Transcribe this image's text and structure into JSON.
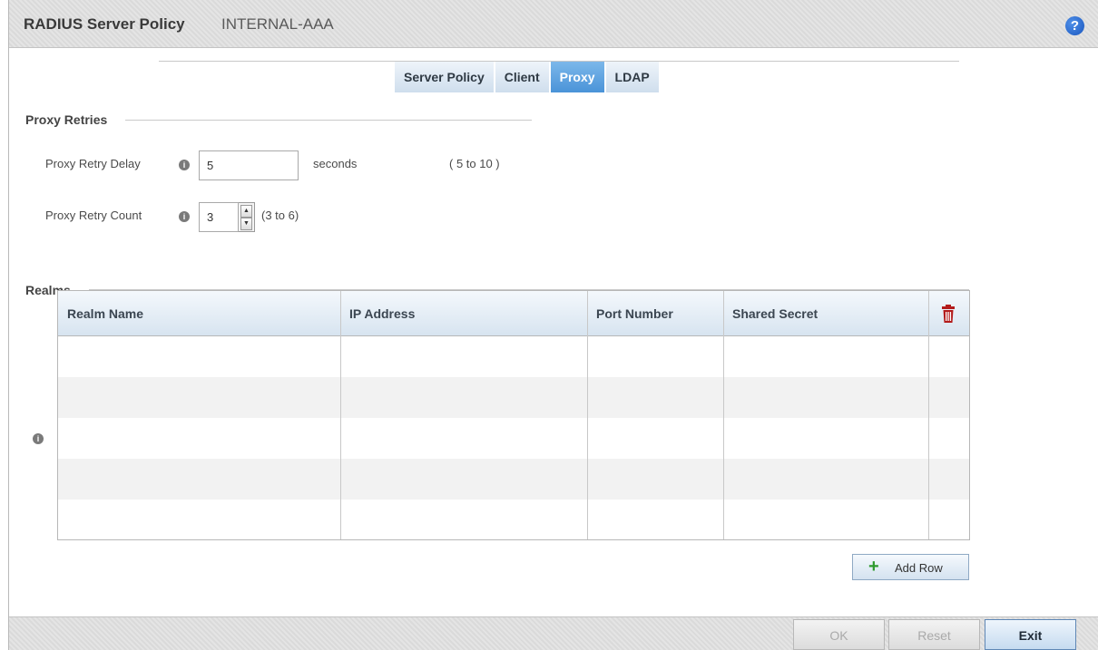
{
  "header": {
    "title": "RADIUS Server Policy",
    "subtitle": "INTERNAL-AAA",
    "help_icon": "?"
  },
  "tabs": [
    {
      "label": "Server Policy",
      "active": false
    },
    {
      "label": "Client",
      "active": false
    },
    {
      "label": "Proxy",
      "active": true
    },
    {
      "label": "LDAP",
      "active": false
    }
  ],
  "proxy_retries": {
    "section_label": "Proxy Retries",
    "delay": {
      "label": "Proxy Retry Delay",
      "value": "5",
      "unit": "seconds",
      "range": "( 5 to 10 )"
    },
    "count": {
      "label": "Proxy Retry Count",
      "value": "3",
      "range": "(3 to 6)"
    }
  },
  "realms": {
    "section_label": "Realms",
    "columns": [
      "Realm Name",
      "IP Address",
      "Port Number",
      "Shared Secret"
    ],
    "rows": [],
    "add_row_label": "Add Row"
  },
  "footer": {
    "ok_label": "OK",
    "reset_label": "Reset",
    "exit_label": "Exit"
  },
  "colors": {
    "active_tab": "#4a93d8",
    "add_icon": "#2e9a2e",
    "delete_icon": "#b31b1b",
    "help_icon": "#1a57bf"
  }
}
